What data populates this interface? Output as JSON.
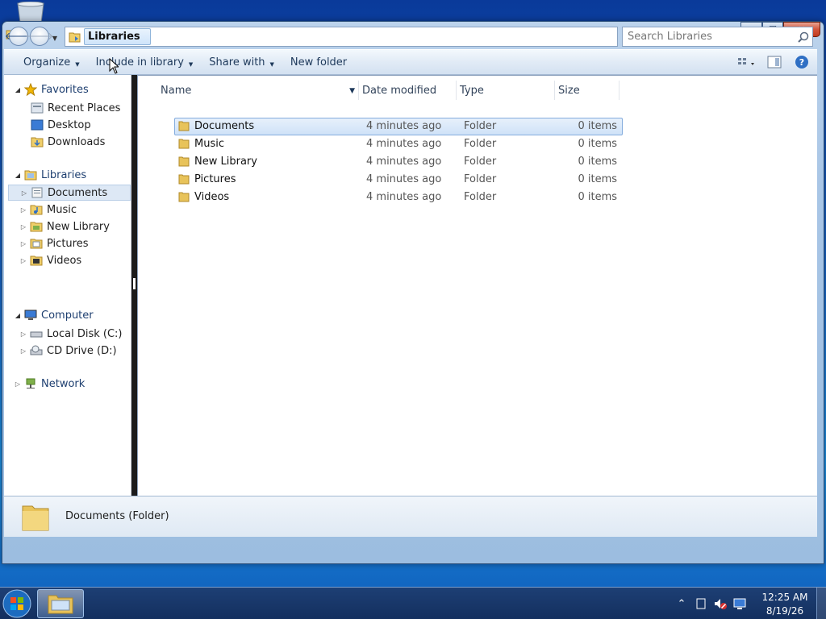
{
  "window": {
    "address_crumb": "Libraries",
    "search_placeholder": "Search Libraries",
    "caption": {
      "minimize": "–",
      "maximize": "☐",
      "close": "✕"
    }
  },
  "toolbar": {
    "organize": "Organize",
    "include_in_library": "Include in library",
    "share_with": "Share with",
    "new_folder": "New folder"
  },
  "nav_pane": {
    "favorites": {
      "label": "Favorites",
      "items": [
        "Recent Places",
        "Desktop",
        "Downloads"
      ]
    },
    "libraries": {
      "label": "Libraries",
      "items": [
        "Documents",
        "Music",
        "New Library",
        "Pictures",
        "Videos"
      ]
    },
    "computer": {
      "label": "Computer",
      "items": [
        "Local Disk (C:)",
        "CD Drive (D:)"
      ]
    },
    "network": {
      "label": "Network"
    }
  },
  "columns": {
    "name": "Name",
    "date": "Date modified",
    "type": "Type",
    "size": "Size"
  },
  "files": [
    {
      "name": "Documents",
      "date": "4 minutes ago",
      "type": "Folder",
      "size": "0 items"
    },
    {
      "name": "Music",
      "date": "4 minutes ago",
      "type": "Folder",
      "size": "0 items"
    },
    {
      "name": "New Library",
      "date": "4 minutes ago",
      "type": "Folder",
      "size": "0 items"
    },
    {
      "name": "Pictures",
      "date": "4 minutes ago",
      "type": "Folder",
      "size": "0 items"
    },
    {
      "name": "Videos",
      "date": "4 minutes ago",
      "type": "Folder",
      "size": "0 items"
    }
  ],
  "details": {
    "text": "Documents (Folder)"
  },
  "taskbar": {
    "time": "12:25 AM",
    "date": "8/19/26"
  },
  "colors": {
    "accent": "#1e395b",
    "selection": "#cfe2f8",
    "folder": "#e8c35a"
  }
}
